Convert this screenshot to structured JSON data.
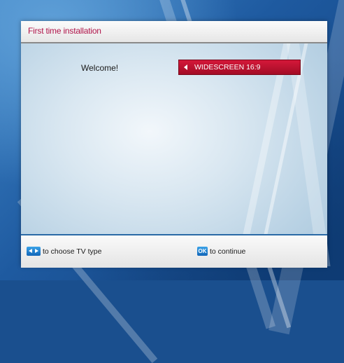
{
  "header": {
    "title": "First time installation"
  },
  "main": {
    "welcome": "Welcome!",
    "tv_type": {
      "value": "WIDESCREEN 16:9"
    }
  },
  "footer": {
    "left_hint": "to choose TV type",
    "ok_key": "OK",
    "right_hint": "to continue"
  },
  "colors": {
    "title": "#b0154a",
    "selector": "#c41230",
    "key": "#1e80d0"
  },
  "icons": {
    "choose": "left-right-arrows-icon",
    "ok": "ok-key-icon",
    "selector": "left-arrow-icon"
  }
}
